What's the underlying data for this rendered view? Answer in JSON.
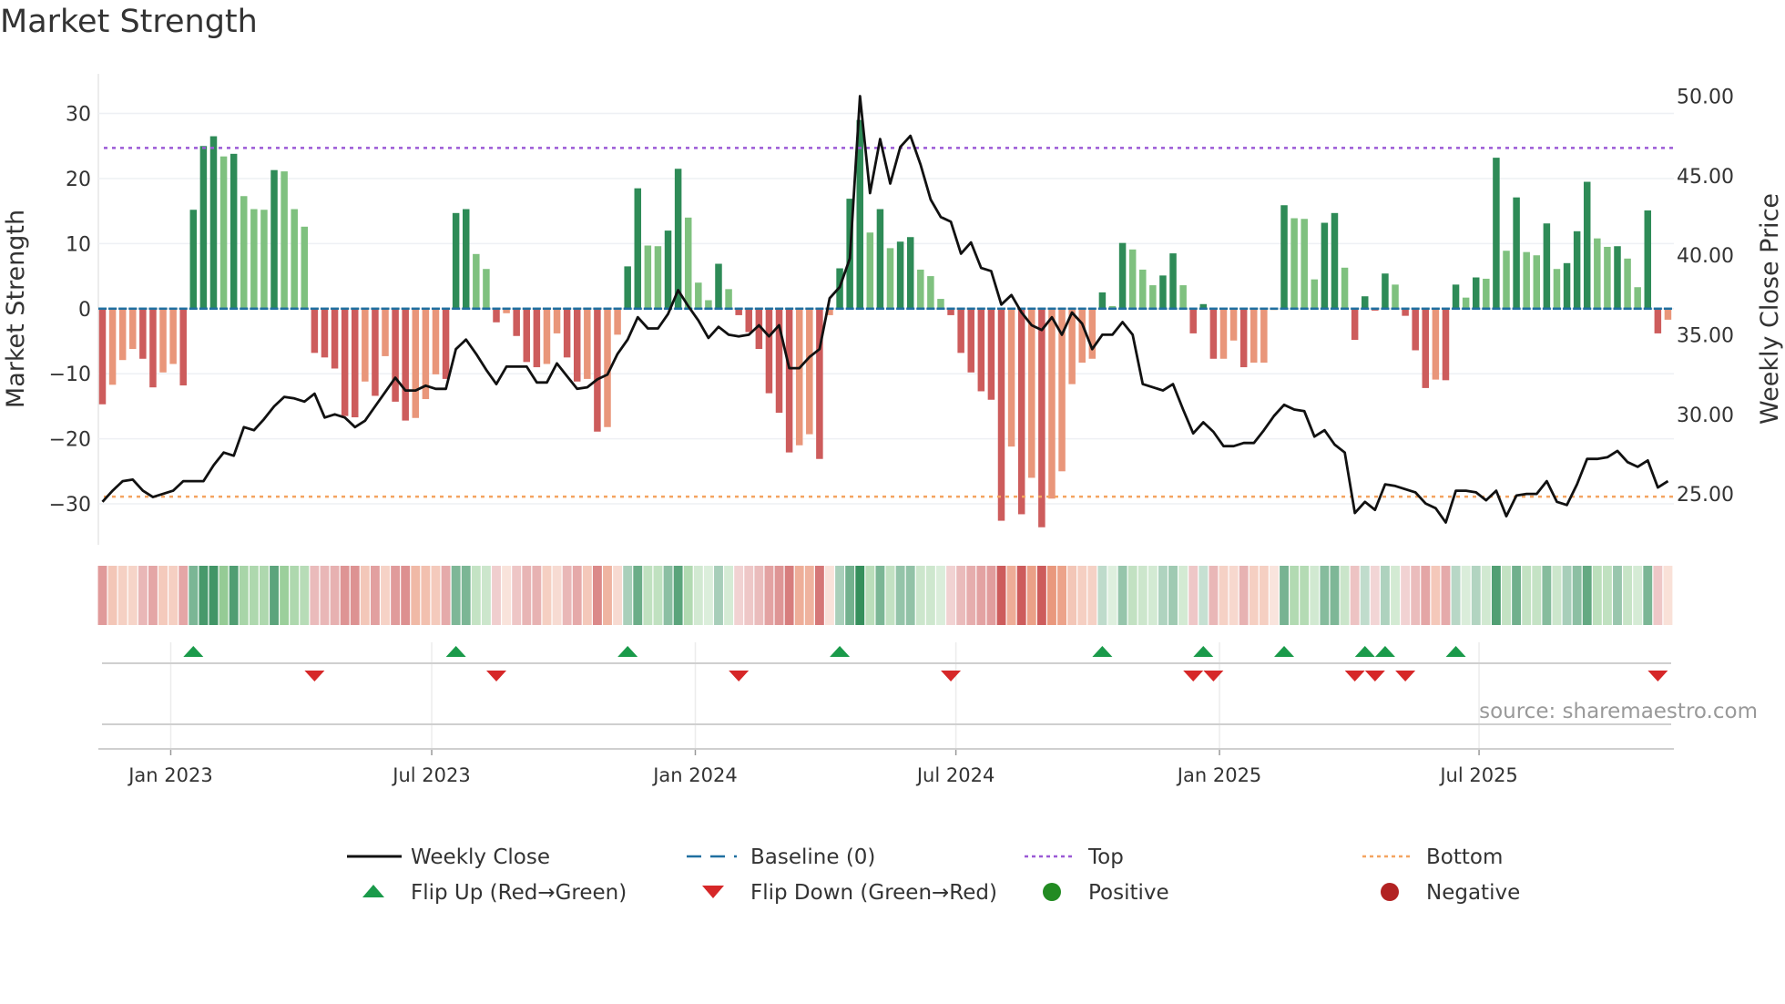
{
  "title": "Market Strength",
  "source": "source: sharemaestro.com",
  "colors": {
    "strong_positive": "#2e8b57",
    "weak_positive": "#7fc17f",
    "strong_negative": "#cd5c5c",
    "weak_negative": "#e9967a",
    "baseline": "#1f6fa0",
    "top": "#9b59d6",
    "bottom": "#f4a460",
    "line": "#111111",
    "flip_up": "#1a9a4a",
    "flip_down": "#d62728",
    "positive": "#228b22",
    "negative": "#b22222"
  },
  "legend": [
    {
      "label": "Weekly Close",
      "kind": "line"
    },
    {
      "label": "Baseline (0)",
      "kind": "baseline"
    },
    {
      "label": "Top",
      "kind": "top"
    },
    {
      "label": "Bottom",
      "kind": "bottom"
    },
    {
      "label": "Flip Up (Red→Green)",
      "kind": "flip_up"
    },
    {
      "label": "Flip Down (Green→Red)",
      "kind": "flip_down"
    },
    {
      "label": "Positive",
      "kind": "positive"
    },
    {
      "label": "Negative",
      "kind": "negative"
    }
  ],
  "chart_data": {
    "type": "bar",
    "title": "Market Strength",
    "ylabel": "Market Strength",
    "y2label": "Weekly Close Price",
    "ylim": [
      -36.3,
      36.1
    ],
    "y2lim": [
      21.8,
      51.4
    ],
    "yticks": [
      -30,
      -20,
      -10,
      0,
      10,
      20,
      30
    ],
    "y2ticks": [
      "25.00",
      "30.00",
      "35.00",
      "40.00",
      "45.00",
      "50.00"
    ],
    "top_level": 24.7,
    "bottom_level": -28.9,
    "baseline": 0,
    "xticks": [
      {
        "label": "Jan 2023",
        "week_index": 6.76
      },
      {
        "label": "Jul 2023",
        "week_index": 32.6
      },
      {
        "label": "Jan 2024",
        "week_index": 58.7
      },
      {
        "label": "Jul 2024",
        "week_index": 84.5
      },
      {
        "label": "Jan 2025",
        "week_index": 110.6
      },
      {
        "label": "Jul 2025",
        "week_index": 136.3
      }
    ],
    "strength": [
      -14.7,
      -11.7,
      -7.9,
      -6.2,
      -7.7,
      -12.1,
      -9.8,
      -8.5,
      -11.8,
      15.2,
      25,
      26.5,
      23.4,
      23.8,
      17.3,
      15.3,
      15.2,
      21.3,
      21.1,
      15.3,
      12.6,
      -6.8,
      -7.5,
      -9.2,
      -16.5,
      -16.7,
      -11.2,
      -13.4,
      -7.3,
      -14.3,
      -17.2,
      -16.8,
      -13.9,
      -10.1,
      -10.8,
      14.7,
      15.3,
      8.4,
      6.1,
      -2.1,
      -0.7,
      -4.2,
      -8.2,
      -9,
      -8.5,
      -3.8,
      -7.5,
      -11.2,
      -10.8,
      -18.9,
      -18.2,
      -4,
      6.5,
      18.5,
      9.7,
      9.6,
      12,
      21.5,
      14,
      4,
      1.3,
      6.9,
      3,
      -1,
      -3.6,
      -6.2,
      -13,
      -16,
      -22.1,
      -21,
      -19.3,
      -23.1,
      -1,
      6.2,
      16.9,
      29,
      11.7,
      15.3,
      9.3,
      10.3,
      11,
      6,
      5,
      1.5,
      -1,
      -6.8,
      -9.8,
      -12.7,
      -14,
      -32.6,
      -21.2,
      -31.6,
      -26,
      -33.6,
      -29.2,
      -25,
      -11.6,
      -8.3,
      -7.7,
      2.5,
      0.4,
      10.1,
      9.1,
      6,
      3.6,
      5.1,
      8.5,
      3.6,
      -3.8,
      0.7,
      -7.7,
      -7.7,
      -4.9,
      -9,
      -8.3,
      -8.3,
      -0.2,
      15.9,
      13.9,
      13.8,
      4.5,
      13.2,
      14.7,
      6.3,
      -4.8,
      1.9,
      -0.3,
      5.4,
      3.7,
      -1.1,
      -6.4,
      -12.2,
      -10.9,
      -11,
      3.7,
      1.7,
      4.8,
      4.6,
      23.2,
      8.9,
      17.1,
      8.7,
      8.2,
      13.1,
      6.1,
      7,
      11.9,
      19.5,
      10.8,
      9.5,
      9.6,
      7.7,
      3.3,
      15.1,
      -3.8,
      -1.7
    ],
    "weekly_close": [
      24.5,
      25.2,
      25.8,
      25.9,
      25.2,
      24.8,
      25.0,
      25.2,
      25.8,
      25.8,
      25.8,
      26.8,
      27.6,
      27.4,
      29.2,
      29.0,
      29.7,
      30.5,
      31.1,
      31.0,
      30.8,
      31.3,
      29.8,
      30.0,
      29.8,
      29.2,
      29.6,
      30.5,
      31.4,
      32.3,
      31.5,
      31.5,
      31.8,
      31.6,
      31.6,
      34.1,
      34.7,
      33.8,
      32.8,
      31.9,
      33.0,
      33.0,
      33.0,
      32.0,
      32.0,
      33.2,
      32.4,
      31.6,
      31.7,
      32.2,
      32.5,
      33.8,
      34.7,
      36.1,
      35.4,
      35.4,
      36.3,
      37.8,
      36.8,
      35.9,
      34.8,
      35.5,
      35.0,
      34.9,
      35.0,
      35.6,
      34.9,
      35.6,
      32.9,
      32.9,
      33.6,
      34.1,
      37.3,
      38.0,
      39.8,
      50.0,
      43.9,
      47.3,
      44.5,
      46.8,
      47.5,
      45.7,
      43.5,
      42.4,
      42.1,
      40.1,
      40.8,
      39.2,
      39.0,
      36.9,
      37.5,
      36.4,
      35.6,
      35.3,
      36.1,
      35.0,
      36.4,
      35.7,
      34.1,
      35.0,
      35.0,
      35.8,
      35.0,
      31.9,
      31.7,
      31.5,
      31.9,
      30.3,
      28.8,
      29.5,
      28.9,
      28.0,
      28.0,
      28.2,
      28.2,
      29.0,
      29.9,
      30.6,
      30.3,
      30.2,
      28.6,
      29.0,
      28.1,
      27.6,
      23.8,
      24.5,
      24.0,
      25.6,
      25.5,
      25.3,
      25.1,
      24.4,
      24.1,
      23.2,
      25.2,
      25.2,
      25.1,
      24.6,
      25.2,
      23.6,
      24.9,
      25.0,
      25.0,
      25.8,
      24.5,
      24.3,
      25.6,
      27.2,
      27.2,
      27.3,
      27.7,
      27.0,
      26.7,
      27.1,
      25.4,
      25.8
    ],
    "flip_up_weeks": [
      9,
      35,
      52,
      73,
      99,
      109,
      117,
      125,
      127,
      134
    ],
    "flip_down_weeks": [
      21,
      39,
      63,
      84,
      108,
      110,
      124,
      126,
      129,
      154
    ]
  }
}
